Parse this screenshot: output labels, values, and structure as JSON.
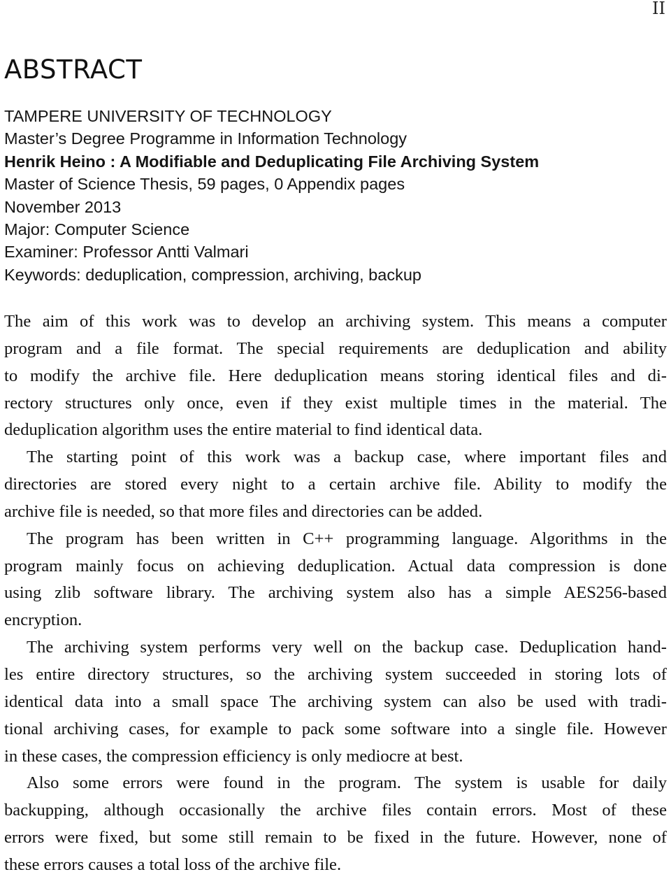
{
  "page": {
    "number": "II",
    "title": "ABSTRACT"
  },
  "meta": {
    "university": "TAMPERE UNIVERSITY OF TECHNOLOGY",
    "programme": "Master’s Degree Programme in Information Technology",
    "author_title": "Henrik Heino : A Modifiable and Deduplicating File Archiving System",
    "thesis_info": "Master of Science Thesis, 59 pages, 0 Appendix pages",
    "date": "November 2013",
    "major": "Major: Computer Science",
    "examiner": "Examiner: Professor Antti Valmari",
    "keywords": "Keywords: deduplication, compression, archiving, backup"
  },
  "body": {
    "paragraphs": [
      {
        "lines": [
          "The aim of this work was to develop an archiving system. This means a computer",
          "program and a file format. The special requirements are deduplication and ability",
          "to modify the archive file. Here deduplication means storing identical files and di-",
          "rectory structures only once, even if they exist multiple times in the material. The",
          "deduplication algorithm uses the entire material to find identical data."
        ]
      },
      {
        "lines": [
          "The starting point of this work was a backup case, where important files and",
          "directories are stored every night to a certain archive file. Ability to modify the",
          "archive file is needed, so that more files and directories can be added."
        ]
      },
      {
        "lines": [
          "The program has been written in C++ programming language. Algorithms in the",
          "program mainly focus on achieving deduplication. Actual data compression is done",
          "using zlib software library. The archiving system also has a simple AES256-based",
          "encryption."
        ]
      },
      {
        "lines": [
          "The archiving system performs very well on the backup case. Deduplication hand-",
          "les entire directory structures, so the archiving system succeeded in storing lots of",
          "identical data into a small space The archiving system can also be used with tradi-",
          "tional archiving cases, for example to pack some software into a single file. However",
          "in these cases, the compression efficiency is only mediocre at best."
        ]
      },
      {
        "lines": [
          "Also some errors were found in the program. The system is usable for daily",
          "backupping, although occasionally the archive files contain errors. Most of these",
          "errors were fixed, but some still remain to be fixed in the future. However, none of",
          "these errors causes a total loss of the archive file."
        ]
      }
    ]
  }
}
